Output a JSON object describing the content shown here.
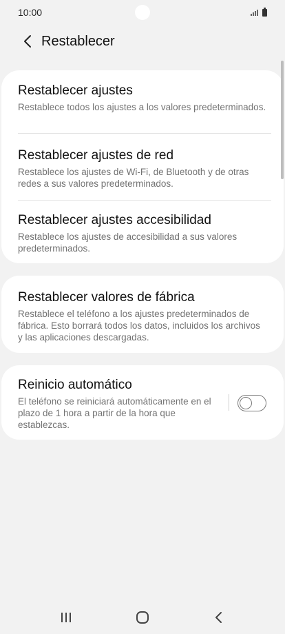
{
  "status_bar": {
    "time": "10:00"
  },
  "header": {
    "title": "Restablecer"
  },
  "reset_options": [
    {
      "title": "Restablecer ajustes",
      "description": "Restablece todos los ajustes a los valores predeterminados."
    },
    {
      "title": "Restablecer ajustes de red",
      "description": "Restablece los ajustes de Wi-Fi, de Bluetooth y de otras redes a sus valores predeterminados."
    },
    {
      "title": "Restablecer ajustes accesibilidad",
      "description": "Restablece los ajustes de accesibilidad a sus valores predeterminados."
    }
  ],
  "factory_reset": {
    "title": "Restablecer valores de fábrica",
    "description": "Restablece el teléfono a los ajustes predeterminados de fábrica. Esto borrará todos los datos, incluidos los archivos y las aplicaciones descargadas."
  },
  "auto_restart": {
    "title": "Reinicio automático",
    "description": "El teléfono se reiniciará automáticamente en el plazo de 1 hora a partir de la hora que establezcas.",
    "enabled": false
  },
  "icons": {
    "back": "chevron-left-icon",
    "recents": "recent-apps-icon",
    "home": "home-icon",
    "nav_back": "nav-back-icon"
  }
}
